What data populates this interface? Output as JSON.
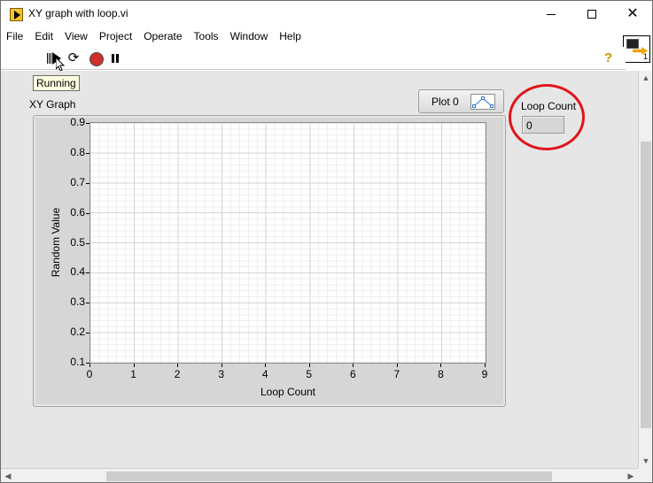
{
  "window": {
    "title": "XY graph with loop.vi"
  },
  "menu": [
    "File",
    "Edit",
    "View",
    "Project",
    "Operate",
    "Tools",
    "Window",
    "Help"
  ],
  "vi_icon": {
    "connector_number": "1"
  },
  "toolbar": {
    "help_label": "?",
    "tooltip": "Running"
  },
  "graph": {
    "label": "XY Graph",
    "plot_legend": "Plot 0",
    "chart_data": {
      "type": "scatter",
      "title": "",
      "xlabel": "Loop Count",
      "ylabel": "Random Value",
      "xlim": [
        0,
        9
      ],
      "ylim": [
        0.1,
        0.9
      ],
      "x_ticks": [
        "0",
        "1",
        "2",
        "3",
        "4",
        "5",
        "6",
        "7",
        "8",
        "9"
      ],
      "y_ticks": [
        "0.9",
        "0.8",
        "0.7",
        "0.6",
        "0.5",
        "0.4",
        "0.3",
        "0.2",
        "0.1"
      ],
      "grid": true,
      "series": [
        {
          "name": "Plot 0",
          "x": [],
          "y": []
        }
      ]
    }
  },
  "loop_count_indicator": {
    "label": "Loop Count",
    "value": "0",
    "highlight_color": "#e0141c"
  }
}
